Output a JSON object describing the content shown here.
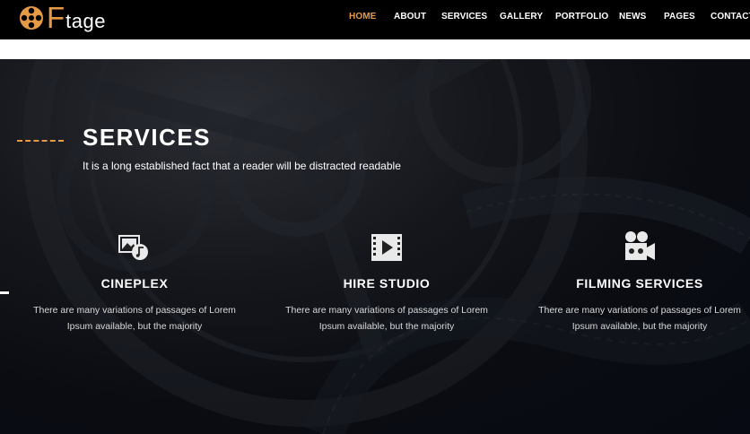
{
  "header": {
    "logo": {
      "letter": "F",
      "rest": "tage"
    },
    "nav": [
      {
        "label": "HOME",
        "active": true
      },
      {
        "label": "ABOUT",
        "active": false
      },
      {
        "label": "SERVICES",
        "active": false
      },
      {
        "label": "GALLERY",
        "active": false
      },
      {
        "label": "PORTFOLIO",
        "active": false
      },
      {
        "label": "NEWS",
        "active": false
      },
      {
        "label": "PAGES",
        "active": false
      },
      {
        "label": "CONTACT",
        "active": false
      }
    ]
  },
  "services_section": {
    "title": "SERVICES",
    "subtitle": "It is a long established fact that a reader will be distracted readable",
    "items": [
      {
        "icon": "media-gallery-icon",
        "title": "CINEPLEX",
        "text_line1": "There are many variations of passages of Lorem",
        "text_line2": "Ipsum available, but the majority"
      },
      {
        "icon": "film-play-icon",
        "title": "HIRE STUDIO",
        "text_line1": "There are many variations of passages of Lorem",
        "text_line2": "Ipsum available, but the majority"
      },
      {
        "icon": "video-camera-icon",
        "title": "FILMING SERVICES",
        "text_line1": "There are many variations of passages of Lorem",
        "text_line2": "Ipsum available, but the majority"
      }
    ]
  },
  "colors": {
    "accent": "#e69a45",
    "header_bg": "#000000",
    "section_bg": "#0a0c12",
    "text": "#ffffff"
  }
}
